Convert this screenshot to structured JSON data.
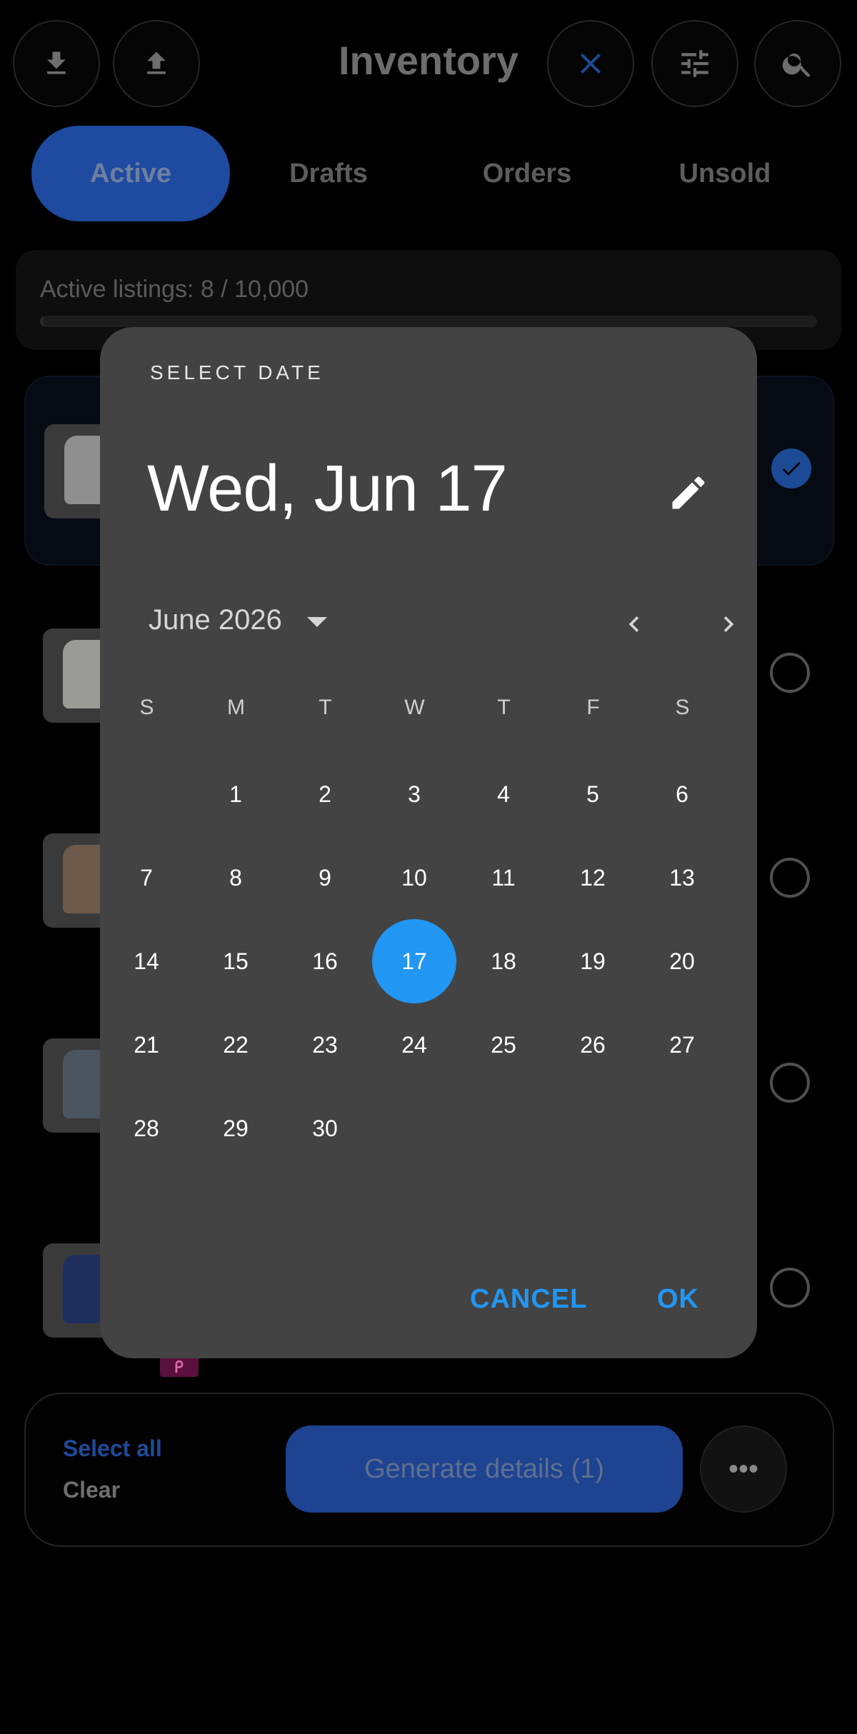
{
  "header": {
    "title": "Inventory",
    "download_icon": "download-icon",
    "upload_icon": "upload-icon",
    "close_icon": "close-icon",
    "filter_icon": "filter-sliders-icon",
    "search_icon": "search-icon"
  },
  "tabs": [
    {
      "label": "Active",
      "selected": true
    },
    {
      "label": "Drafts",
      "selected": false
    },
    {
      "label": "Orders",
      "selected": false
    },
    {
      "label": "Unsold",
      "selected": false
    }
  ],
  "quota": {
    "label": "Active listings: 8 / 10,000",
    "fraction": 0.0008
  },
  "listings": [
    {
      "selected": true
    },
    {
      "selected": false
    },
    {
      "selected": false
    },
    {
      "selected": false
    },
    {
      "selected": false
    }
  ],
  "bottom_bar": {
    "select_all": "Select all",
    "clear": "Clear",
    "generate": "Generate details (1)",
    "more": "•••"
  },
  "date_picker": {
    "header_label": "SELECT DATE",
    "selected_date": "Wed, Jun 17",
    "month_label": "June 2026",
    "weekdays": [
      "S",
      "M",
      "T",
      "W",
      "T",
      "F",
      "S"
    ],
    "first_weekday_index": 1,
    "days_in_month": 30,
    "selected_day": 17,
    "cancel": "CANCEL",
    "ok": "OK"
  },
  "colors": {
    "accent": "#2196f3",
    "dialog_bg": "#434343",
    "tab_active_bg": "#1e4aa0"
  }
}
